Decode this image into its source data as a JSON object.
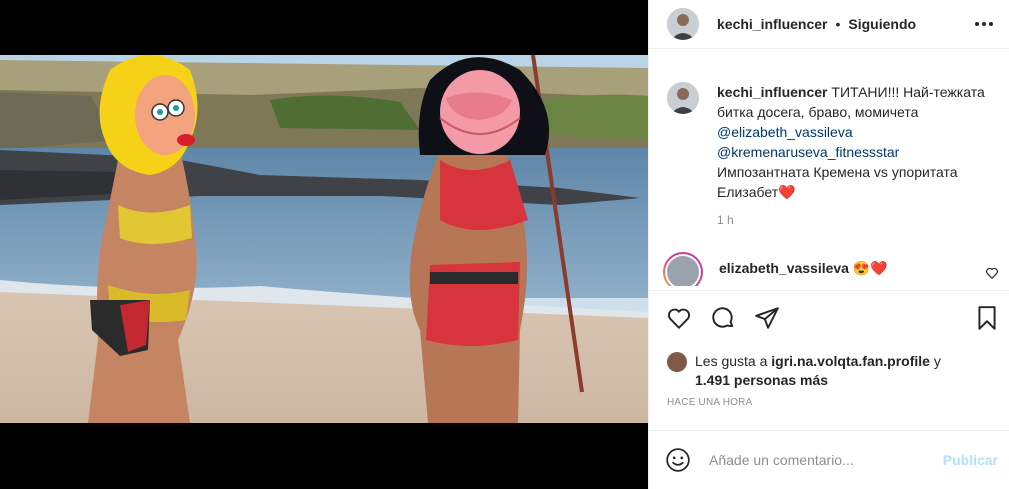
{
  "post": {
    "header": {
      "username": "kechi_influencer",
      "separator": "•",
      "follow_status": "Siguiendo",
      "more_icon": "more-horizontal-icon"
    },
    "caption": {
      "username": "kechi_influencer",
      "text": "ТИТАНИ!!! Най-тежката битка досега, браво, момичета",
      "mention1": "@elizabeth_vassileva",
      "mention2": "@kremenaruseva_fitnessstar",
      "text2": "Импозантната Кремена vs упоритата Елизабет",
      "emoji": "❤️",
      "time": "1 h"
    },
    "comment": {
      "username": "elizabeth_vassileva",
      "text": "😍❤️"
    },
    "actions": {
      "like_icon": "heart-icon",
      "comment_icon": "comment-icon",
      "share_icon": "share-icon",
      "save_icon": "bookmark-icon"
    },
    "likes": {
      "prefix": "Les gusta a",
      "user": "igri.na.volqta.fan.profile",
      "conj": "y",
      "others": "1.491 personas más"
    },
    "timestamp": "Hace una hora",
    "add_comment": {
      "placeholder": "Añade un comentario...",
      "publish_label": "Publicar",
      "emoji_icon": "smiley-icon"
    }
  },
  "colors": {
    "link": "#00376b",
    "publish_disabled": "#b2dffc",
    "muted": "#8e8e8e",
    "heart": "#ed1c24"
  }
}
